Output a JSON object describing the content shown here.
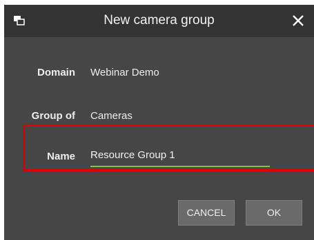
{
  "dialog": {
    "title": "New camera group",
    "icons": {
      "app": "camera-group-icon",
      "close": "close-icon"
    },
    "fields": {
      "domain": {
        "label": "Domain",
        "value": "Webinar Demo"
      },
      "group_of": {
        "label": "Group of",
        "value": "Cameras"
      },
      "name": {
        "label": "Name",
        "value": "Resource Group 1"
      }
    },
    "buttons": {
      "cancel": "CANCEL",
      "ok": "OK"
    }
  },
  "colors": {
    "dialog_bg": "#464646",
    "titlebar_bg": "#333333",
    "input_underline": "#8cbf45",
    "highlight_border": "#e00000"
  }
}
